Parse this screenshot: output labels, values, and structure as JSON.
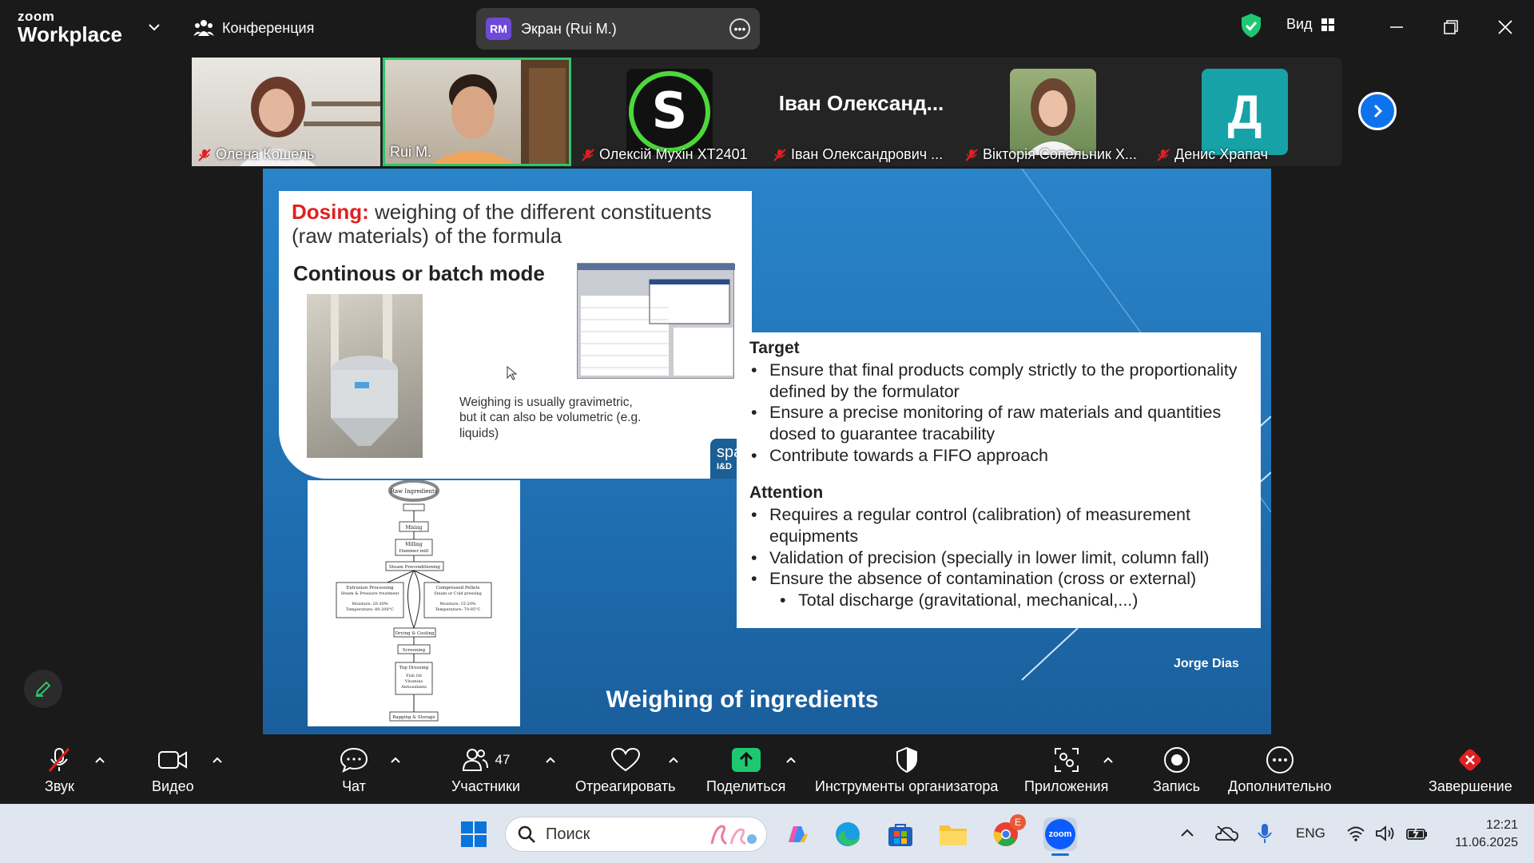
{
  "app": {
    "logo_top": "zoom",
    "logo_bottom": "Workplace",
    "conference_label": "Конференция",
    "screen_share_label": "Экран (Rui M.)",
    "screen_share_initials": "RM",
    "view_label": "Вид"
  },
  "participants": [
    {
      "name": "Олена Кошель",
      "muted": true
    },
    {
      "name": "Rui M.",
      "muted": false
    },
    {
      "name": "Олексій Мухін ХТ2401",
      "muted": true,
      "avatar_letter": "S"
    },
    {
      "name": "Іван Олександрович ...",
      "muted": true,
      "display": "Іван  Олександ..."
    },
    {
      "name": "Вікторія Сопельник Х...",
      "muted": true
    },
    {
      "name": "Денис Храпач",
      "muted": true,
      "avatar_letter": "Д"
    }
  ],
  "slide": {
    "dosing_word": "Dosing:",
    "dosing_rest": " weighing of the different constituents (raw materials) of the formula",
    "mode_heading": "Continous or batch mode",
    "weigh_note": "Weighing is usually gravimetric, but it can also be volumetric (e.g. liquids)",
    "logo_text": "spar",
    "logo_sub": "I&D",
    "target_heading": "Target",
    "target_items": [
      "Ensure that final products comply strictly to the proportionality defined by the formulator",
      "Ensure a precise monitoring of raw materials and quantities dosed to guarantee tracability",
      "Contribute towards a FIFO approach"
    ],
    "attention_heading": "Attention",
    "attention_items": [
      "Requires a regular control (calibration) of measurement equipments",
      "Validation of precision (specially in lower limit, column fall)",
      "Ensure the absence of contamination (cross or external)"
    ],
    "attention_sub": "Total discharge (gravitational, mechanical,...)",
    "author": "Jorge Dias",
    "title": "Weighing of ingredients",
    "flow": {
      "raw": "Raw Ingredients",
      "mixing": "Mixing",
      "milling": "Milling",
      "milling_sub": "Hammer mill",
      "steam": "Steam Preconditioning",
      "extrusion": "Extrusion Processing",
      "extrusion_sub": "Steam & Pressure treatment",
      "extrusion_vals": "Moisture: 20-30%",
      "extrusion_vals2": "Temperature: 80-200°C",
      "pellets": "Compressed Pellets",
      "pellets_sub": "Steam or Cold pressing",
      "pellets_vals": "Moisture: 15-20%",
      "pellets_vals2": "Temperature: 70-85°C",
      "drying": "Drying & Cooling",
      "screening": "Screening",
      "topdress": "Top Dressing",
      "topdress_1": "Fish Oil",
      "topdress_2": "Vitamins",
      "topdress_3": "Antioxidants",
      "bagging": "Bagging & Storage"
    }
  },
  "controls": {
    "sound": "Звук",
    "video": "Видео",
    "chat": "Чат",
    "participants": "Участники",
    "participants_count": "47",
    "react": "Отреагировать",
    "share": "Поделиться",
    "host_tools": "Инструменты организатора",
    "apps": "Приложения",
    "record": "Запись",
    "more": "Дополнительно",
    "end": "Завершение"
  },
  "taskbar": {
    "search_placeholder": "Поиск",
    "lang": "ENG",
    "time": "12:21",
    "date": "11.06.2025",
    "chrome_badge": "E",
    "zoom_label": "zoom"
  },
  "colors": {
    "accent_blue": "#0e72ed",
    "active_speaker": "#2ec56b",
    "end_red": "#e02020",
    "share_green": "#1ec870"
  }
}
